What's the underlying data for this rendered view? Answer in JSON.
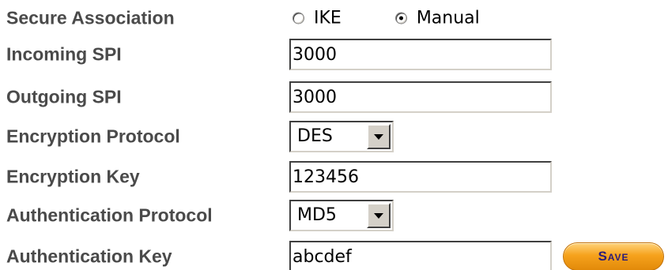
{
  "form": {
    "secure_association": {
      "label": "Secure Association",
      "options": [
        {
          "label": "IKE",
          "selected": false
        },
        {
          "label": "Manual",
          "selected": true
        }
      ]
    },
    "incoming_spi": {
      "label": "Incoming SPI",
      "value": "3000"
    },
    "outgoing_spi": {
      "label": "Outgoing SPI",
      "value": "3000"
    },
    "encryption_protocol": {
      "label": "Encryption Protocol",
      "value": "DES"
    },
    "encryption_key": {
      "label": "Encryption Key",
      "value": "123456"
    },
    "authentication_protocol": {
      "label": "Authentication Protocol",
      "value": "MD5"
    },
    "authentication_key": {
      "label": "Authentication Key",
      "value": "abcdef"
    },
    "save_label": "Save"
  },
  "colors": {
    "label_text": "#4a4a4a",
    "save_button_fill": "#f6a21c",
    "save_button_text": "#2a1c7a"
  }
}
